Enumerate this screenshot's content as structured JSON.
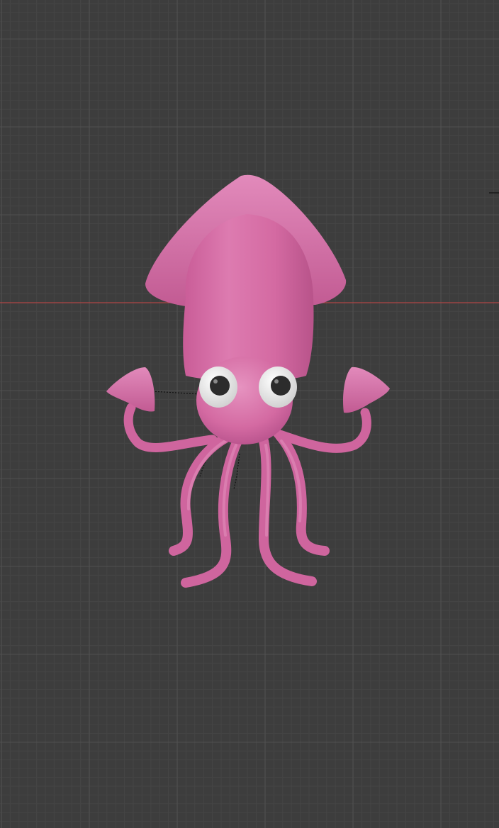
{
  "viewport": {
    "background_color": "#3d3d3d",
    "grid_minor_color": "#454545",
    "grid_major_color": "#505050",
    "x_axis_color": "#b04545",
    "grid": true
  },
  "object": {
    "name": "squid",
    "body_color": "#d56ba3",
    "body_shadow_color": "#b8538a",
    "body_highlight_color": "#e58fbd",
    "eye_white_color": "#f2f2f2",
    "eye_pupil_color": "#2c2c2c"
  },
  "gizmo": {
    "icon": "axis-tick-icon"
  }
}
